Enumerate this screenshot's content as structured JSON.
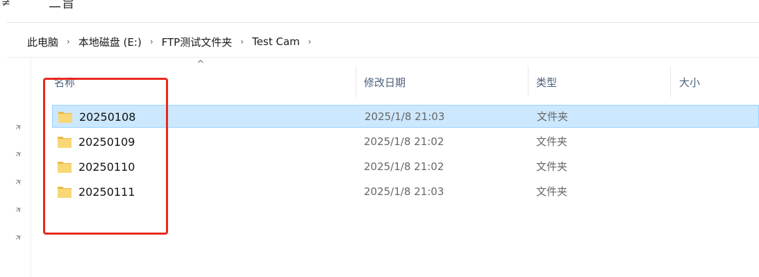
{
  "top_strip": {
    "tick_glyph": "≠",
    "cut_text": "二旨"
  },
  "breadcrumb": [
    {
      "label": "此电脑"
    },
    {
      "label": "本地磁盘 (E:)"
    },
    {
      "label": "FTP测试文件夹"
    },
    {
      "label": "Test Cam"
    }
  ],
  "breadcrumb_separator": "›",
  "columns": {
    "name": "名称",
    "date": "修改日期",
    "type": "类型",
    "size": "大小",
    "sort_indicator": "^"
  },
  "rows": [
    {
      "name": "20250108",
      "date": "2025/1/8 21:03",
      "type": "文件夹",
      "selected": true
    },
    {
      "name": "20250109",
      "date": "2025/1/8 21:02",
      "type": "文件夹",
      "selected": false
    },
    {
      "name": "20250110",
      "date": "2025/1/8 21:02",
      "type": "文件夹",
      "selected": false
    },
    {
      "name": "20250111",
      "date": "2025/1/8 21:03",
      "type": "文件夹",
      "selected": false
    }
  ],
  "pin_glyph": "✈",
  "colors": {
    "selection_bg": "#cce8ff",
    "selection_border": "#99d1ff",
    "annotation_red": "#e8291c",
    "folder_yellow": "#f8d775",
    "header_text": "#4c607a"
  },
  "icons": {
    "folder": "folder-icon",
    "pin": "pin-icon",
    "chevron": "chevron-right-icon",
    "sort": "sort-ascending-icon"
  }
}
